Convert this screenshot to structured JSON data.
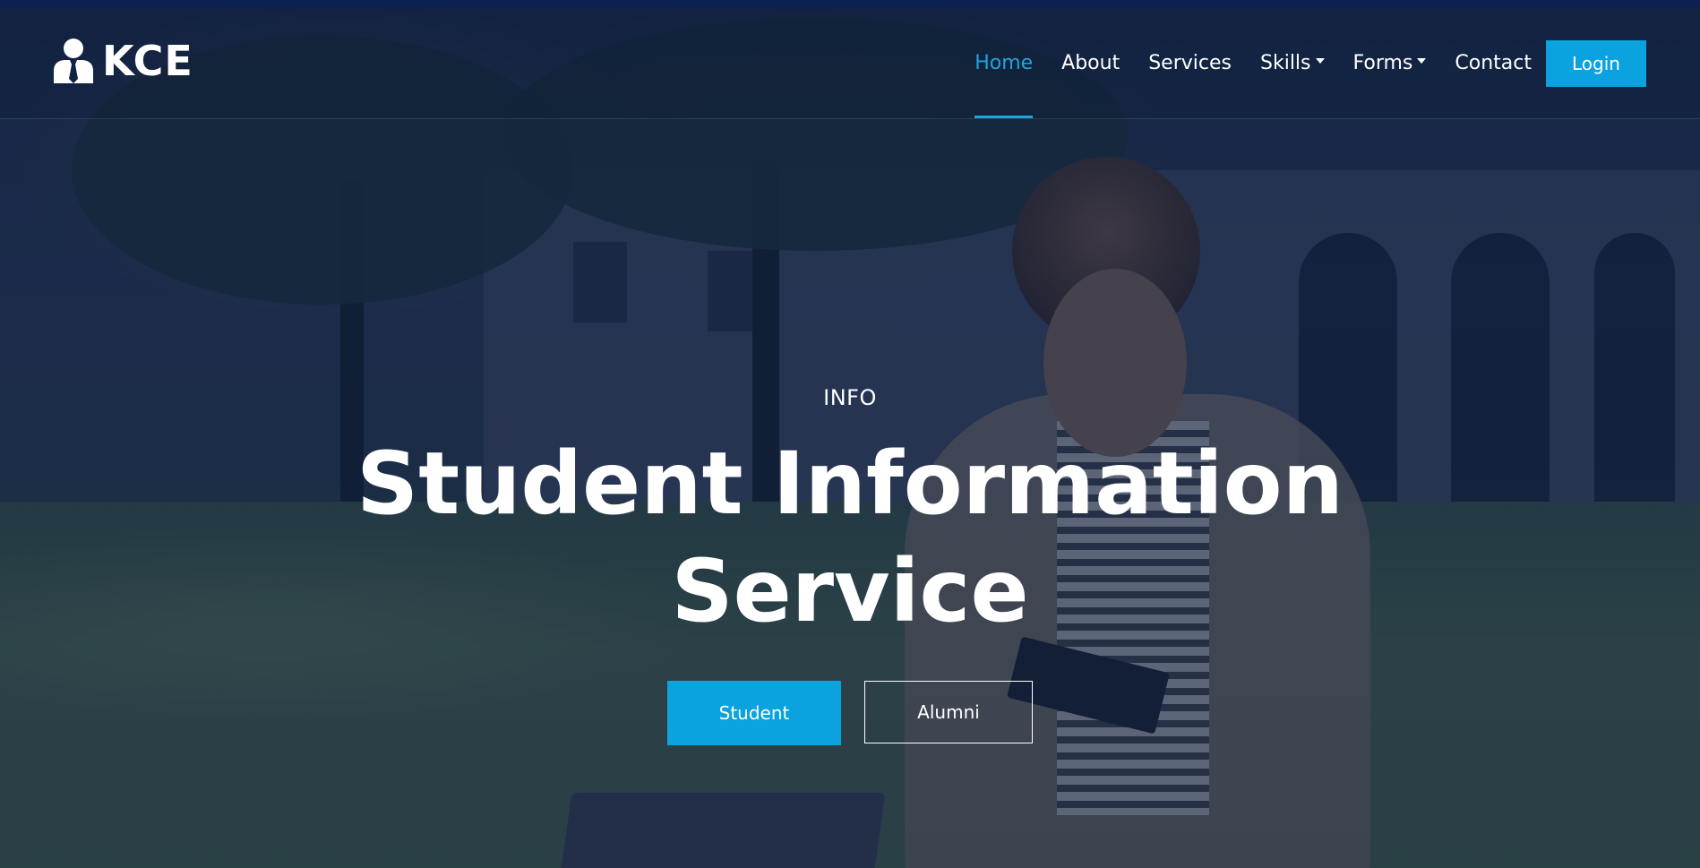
{
  "brand": {
    "name": "KCE",
    "icon": "user-tie-icon"
  },
  "nav": {
    "items": [
      {
        "label": "Home",
        "active": true,
        "dropdown": false
      },
      {
        "label": "About",
        "active": false,
        "dropdown": false
      },
      {
        "label": "Services",
        "active": false,
        "dropdown": false
      },
      {
        "label": "Skills",
        "active": false,
        "dropdown": true
      },
      {
        "label": "Forms",
        "active": false,
        "dropdown": true
      },
      {
        "label": "Contact",
        "active": false,
        "dropdown": false
      }
    ],
    "login_label": "Login"
  },
  "hero": {
    "eyebrow": "INFO",
    "title_line1": "Student Information",
    "title_line2": "Service",
    "primary_button": "Student",
    "secondary_button": "Alumni"
  },
  "colors": {
    "accent": "#0aa2df",
    "active_nav": "#21a3df",
    "overlay": "#0c1e42"
  }
}
